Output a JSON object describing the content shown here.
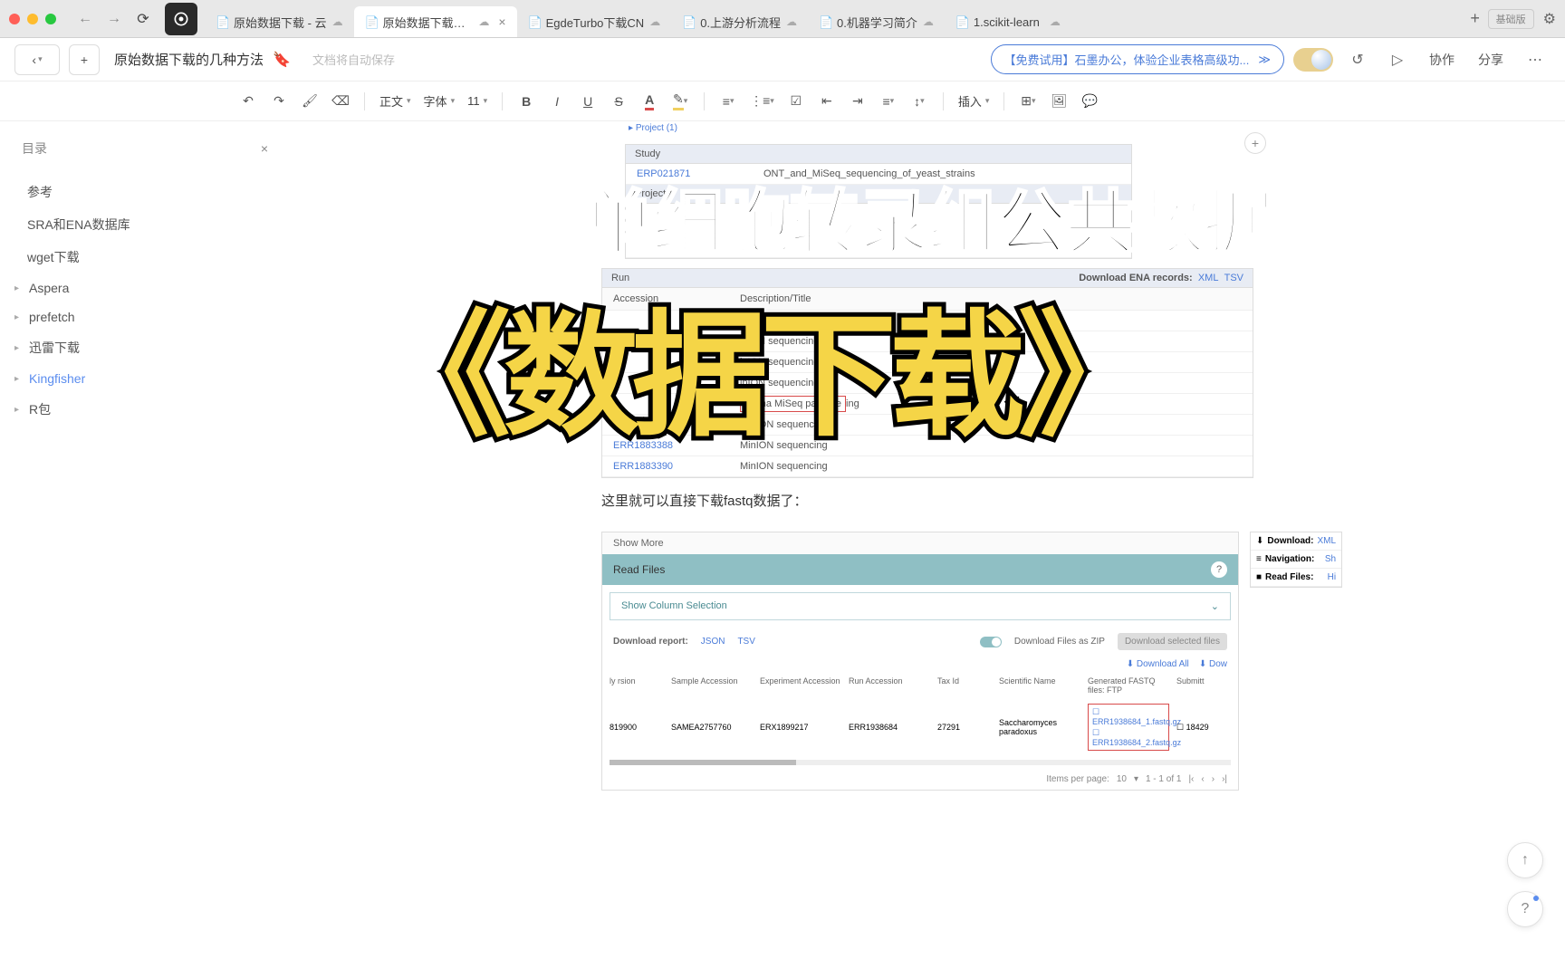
{
  "browser": {
    "tabs": [
      {
        "label": "原始数据下载 - 云",
        "active": false
      },
      {
        "label": "原始数据下载的几",
        "active": true
      },
      {
        "label": "EgdeTurbo下载CN",
        "active": false
      },
      {
        "label": "0.上游分析流程",
        "active": false
      },
      {
        "label": "0.机器学习简介",
        "active": false
      },
      {
        "label": "1.scikit-learn",
        "active": false
      }
    ],
    "badge": "基础版"
  },
  "header": {
    "title": "原始数据下载的几种方法",
    "placeholder": "文档将自动保存",
    "promo": "【免费试用】石墨办公，体验企业表格高级功...",
    "collab": "协作",
    "share": "分享"
  },
  "toolbar": {
    "style": "正文",
    "font": "字体",
    "size": "11",
    "insert": "插入"
  },
  "sidebar": {
    "title": "目录",
    "items": [
      {
        "label": "参考",
        "exp": false
      },
      {
        "label": "SRA和ENA数据库",
        "exp": false
      },
      {
        "label": "wget下载",
        "exp": false
      },
      {
        "label": "Aspera",
        "exp": true
      },
      {
        "label": "prefetch",
        "exp": true
      },
      {
        "label": "迅雷下载",
        "exp": true
      },
      {
        "label": "Kingfisher",
        "exp": true,
        "hl": true
      },
      {
        "label": "R包",
        "exp": true
      }
    ]
  },
  "doc": {
    "project_label": "Project (1)",
    "study_hdr": "Study",
    "study_id": "ERP021871",
    "study_desc": "ONT_and_MiSeq_sequencing_of_yeast_strains",
    "project_hdr": "Project",
    "run_hdr": "Run",
    "ena_label": "Download ENA records:",
    "xml": "XML",
    "tsv": "TSV",
    "acc_hdr": "Accession",
    "desc_hdr": "Description/Title",
    "runs": [
      {
        "acc": "",
        "desc": "inION sequencing"
      },
      {
        "acc": "",
        "desc": "inION sequencing"
      },
      {
        "acc": "",
        "desc": "inION sequencing"
      },
      {
        "acc": "",
        "desc": "inION sequencing"
      },
      {
        "acc": "",
        "desc": "umina MiSeq paired e",
        "red": true,
        "tail": "ing"
      },
      {
        "acc": "ERR1883386",
        "desc": "MinION sequencing"
      },
      {
        "acc": "ERR1883388",
        "desc": "MinION sequencing"
      },
      {
        "acc": "ERR1883390",
        "desc": "MinION sequencing"
      }
    ],
    "body_text": "这里就可以直接下载fastq数据了：",
    "overlay1": "单细胞转录组公共数据",
    "overlay2": "《数据下载》",
    "ena_panel": {
      "show_more": "Show More",
      "read_files": "Read Files",
      "col_sel": "Show Column Selection",
      "dl_report": "Download report:",
      "json": "JSON",
      "tsv": "TSV",
      "zip_label": "Download Files as ZIP",
      "sel_btn": "Download selected files",
      "dl_all": "⬇ Download All",
      "dow": "⬇ Dow",
      "cols": [
        "ly rsion",
        "Sample Accession",
        "Experiment Accession",
        "Run Accession",
        "Tax Id",
        "Scientific Name",
        "Generated FASTQ files: FTP",
        "Submitt"
      ],
      "row": {
        "v1": "819900",
        "v2": "SAMEA2757760",
        "v3": "ERX1899217",
        "v4": "ERR1938684",
        "v5": "27291",
        "v6": "Saccharomyces paradoxus",
        "f1": "ERR1938684_1.fastq.gz",
        "f2": "ERR1938684_2.fastq.gz",
        "v7": "18429"
      },
      "pager": {
        "ipp": "Items per page:",
        "n": "10",
        "range": "1 - 1 of 1"
      },
      "side": [
        {
          "icon": "⬇",
          "label": "Download:",
          "val": "XML"
        },
        {
          "icon": "≡",
          "label": "Navigation:",
          "val": "Sh"
        },
        {
          "icon": "■",
          "label": "Read Files:",
          "val": "Hi"
        }
      ]
    }
  }
}
